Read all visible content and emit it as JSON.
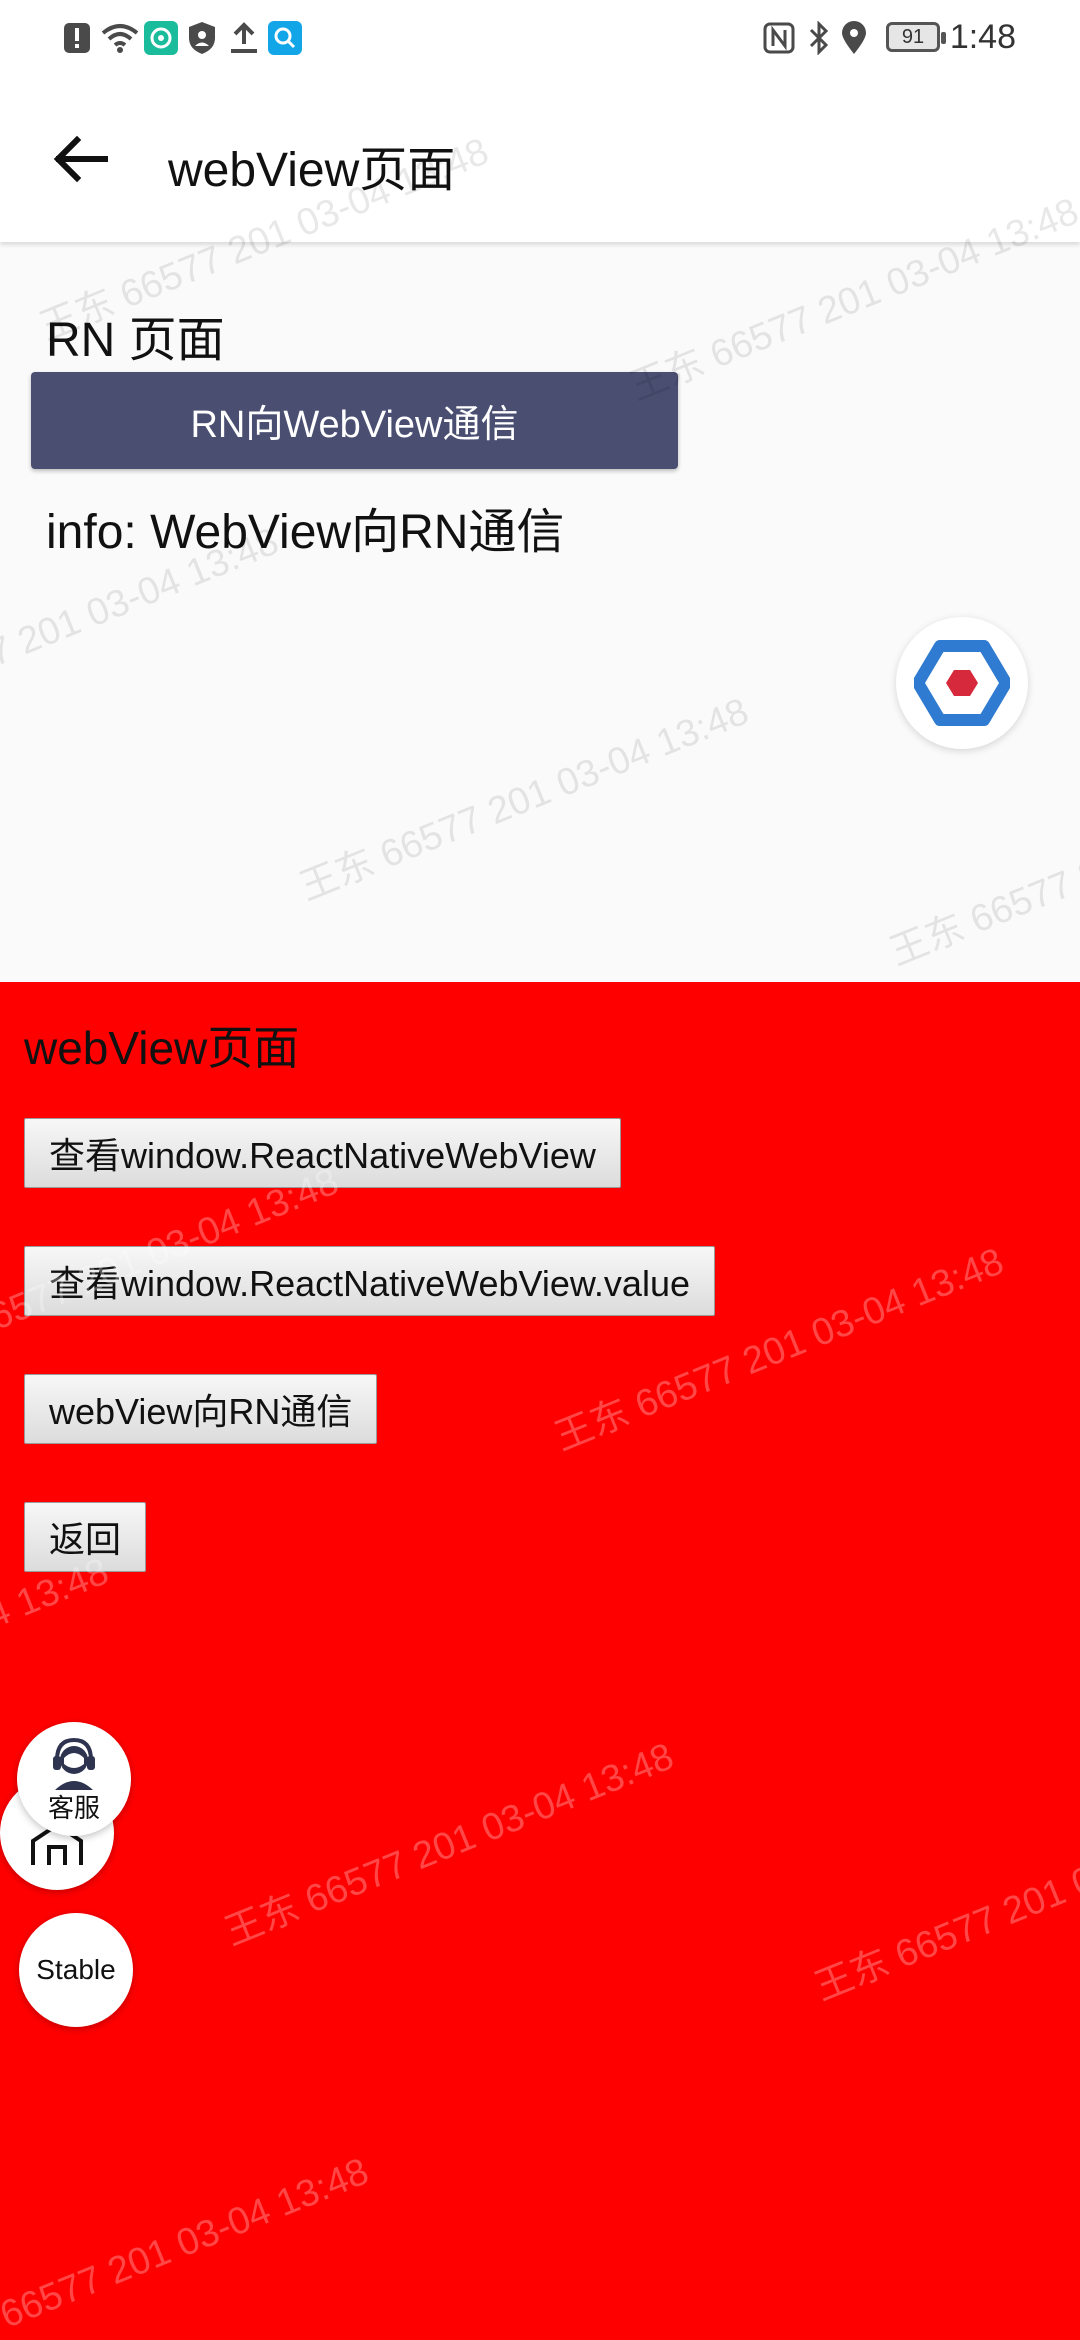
{
  "status_bar": {
    "time": "1:48",
    "battery": "91",
    "icons_left": [
      "notification-alert-icon",
      "wifi-icon",
      "app-green-icon",
      "shield-user-icon",
      "upload-icon",
      "search-app-icon"
    ],
    "icons_right": [
      "nfc-icon",
      "bluetooth-icon",
      "location-icon",
      "battery-icon"
    ]
  },
  "app_bar": {
    "title": "webView页面",
    "back_icon": "back-arrow-icon"
  },
  "rn": {
    "title": "RN 页面",
    "button_label": "RN向WebView通信",
    "info": "info: WebView向RN通信",
    "button_color": "#4a4f72",
    "logo_icon": "hexagon-logo-icon"
  },
  "webview": {
    "background": "#ff0000",
    "title": "webView页面",
    "buttons": [
      {
        "label": "查看window.ReactNativeWebView"
      },
      {
        "label": "查看window.ReactNativeWebView.value"
      },
      {
        "label": "webView向RN通信"
      },
      {
        "label": "返回"
      }
    ]
  },
  "floating": {
    "customer_service_label": "客服",
    "stable_label": "Stable",
    "home_icon": "home-icon",
    "agent_icon": "headset-agent-icon"
  },
  "watermark": {
    "line1": "王东  66577  201  03-04 13:48"
  }
}
